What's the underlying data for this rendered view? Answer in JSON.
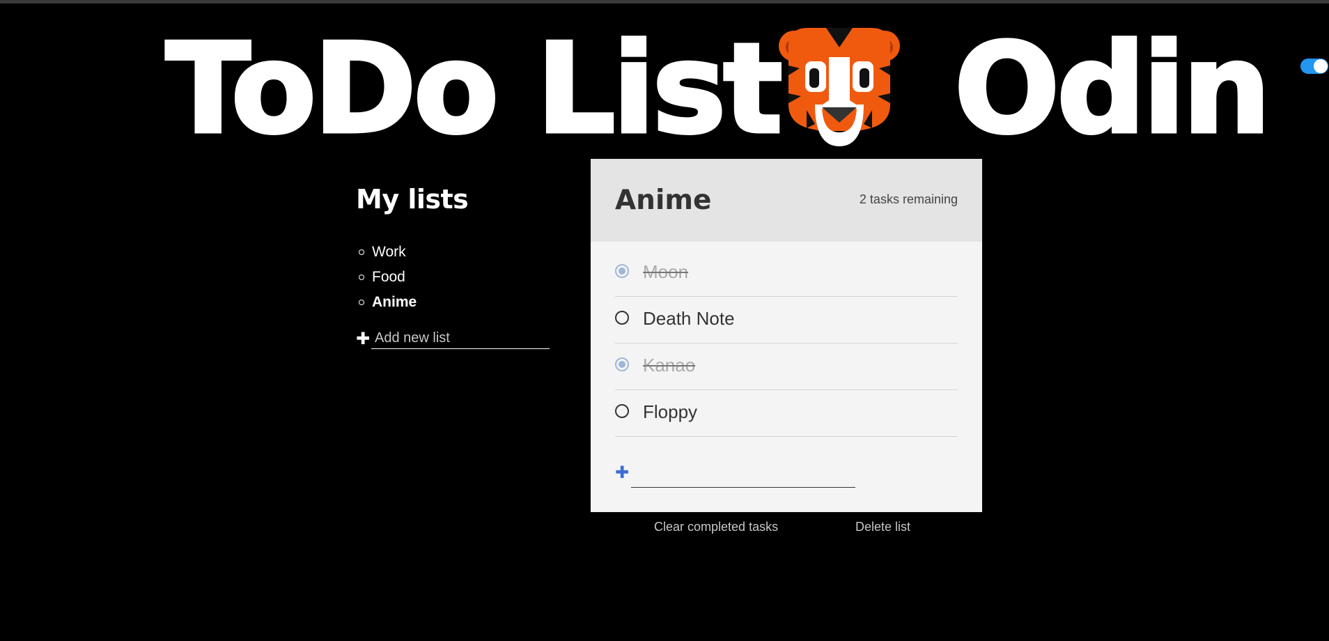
{
  "header": {
    "title_left": "ToDo List",
    "title_right": "Odin",
    "logo_icon": "tiger-logo-icon",
    "theme_toggle": "toggle-switch-icon"
  },
  "sidebar": {
    "title": "My lists",
    "items": [
      {
        "label": "Work",
        "active": false
      },
      {
        "label": "Food",
        "active": false
      },
      {
        "label": "Anime",
        "active": true
      }
    ],
    "add_list_placeholder": "Add new list",
    "add_icon": "plus-icon"
  },
  "panel": {
    "title": "Anime",
    "remaining": "2 tasks remaining",
    "tasks": [
      {
        "label": "Moon",
        "done": true
      },
      {
        "label": "Death Note",
        "done": false
      },
      {
        "label": "Kanao",
        "done": true
      },
      {
        "label": "Floppy",
        "done": false
      }
    ],
    "new_task_value": ""
  },
  "actions": {
    "clear_completed": "Clear completed tasks",
    "delete_list": "Delete list"
  },
  "colors": {
    "background": "#000000",
    "panel": "#f4f4f4",
    "panel_header": "#e4e4e4",
    "accent_blue": "#3b6fd1",
    "toggle": "#2196f3",
    "tiger_orange": "#f05a0f"
  }
}
